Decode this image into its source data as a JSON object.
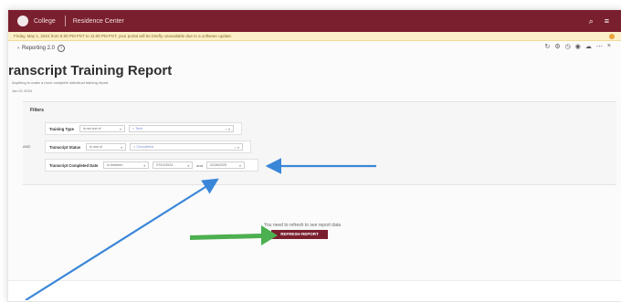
{
  "header": {
    "brand": "College",
    "section": "Residence Center",
    "right_icons": [
      "search-icon",
      "menu-icon"
    ]
  },
  "banner": {
    "text": "Friday, May 1, 2024 from 9:00 PM PST to 11:00 PM PST, your portal will be briefly unavailable due to a software update."
  },
  "breadcrumb": {
    "label": "Reporting 2.0",
    "help": "?"
  },
  "toolbar": {
    "icons": [
      "refresh-icon",
      "settings-icon",
      "history-icon",
      "share-icon",
      "cloud-icon",
      "more-icon",
      "close-icon"
    ]
  },
  "report": {
    "title": "ranscript Training Report",
    "subtitle": "Anything to make a more complete individual training report",
    "date": "Jun 01 2024"
  },
  "filters": {
    "label": "Filters",
    "side_label": "AND",
    "rows": [
      {
        "label": "Training Type",
        "operator": "is not one of",
        "value": "×  Tech"
      },
      {
        "label": "Transcript Status",
        "operator": "is one of",
        "value": "×  Completed"
      },
      {
        "label": "Transcript Completed Date",
        "operator": "is between",
        "start": "07/01/2024",
        "and": "and",
        "end": "02/28/2025"
      }
    ]
  },
  "refresh": {
    "message": "You need to refresh to see report data",
    "button": "REFRESH REPORT"
  },
  "colors": {
    "brand": "#7a1f2e",
    "banner_bg": "#fbf0c8",
    "annotation_blue": "#3a86d8",
    "annotation_green": "#4caf50"
  }
}
